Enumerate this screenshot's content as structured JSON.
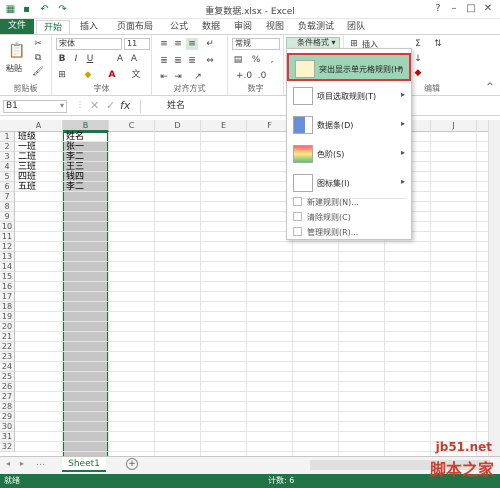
{
  "title": "重复数据.xlsx - Excel",
  "tabs": [
    "文件",
    "开始",
    "插入",
    "页面布局",
    "公式",
    "数据",
    "审阅",
    "视图",
    "负载测试",
    "团队"
  ],
  "ribbon": {
    "paste": "粘贴",
    "font_name": "宋体",
    "font_size": "11",
    "number_format": "常规",
    "cond_format": "条件格式",
    "insert": "插入",
    "groups": [
      "剪贴板",
      "字体",
      "对齐方式",
      "数字",
      "编辑"
    ]
  },
  "formula_bar": {
    "name_box": "B1",
    "content": "姓名"
  },
  "columns": [
    "A",
    "B",
    "C",
    "D",
    "E",
    "F",
    "G",
    "H",
    "I",
    "J"
  ],
  "rows": [
    "1",
    "2",
    "3",
    "4",
    "5",
    "6",
    "7",
    "8",
    "9",
    "10",
    "11",
    "12",
    "13",
    "14",
    "15",
    "16",
    "17",
    "18",
    "19",
    "20",
    "21",
    "22",
    "23",
    "24",
    "25",
    "26",
    "27",
    "28",
    "29",
    "30",
    "31",
    "32"
  ],
  "cells": [
    [
      "班级",
      "姓名"
    ],
    [
      "一班",
      "张一"
    ],
    [
      "二班",
      "李二"
    ],
    [
      "三班",
      "王三"
    ],
    [
      "四班",
      "钱四"
    ],
    [
      "五班",
      "李二"
    ]
  ],
  "menu": {
    "items": [
      {
        "label": "突出显示单元格规则(H)",
        "icon": "highlight-rules-icon"
      },
      {
        "label": "项目选取规则(T)",
        "icon": "top-bottom-rules-icon"
      },
      {
        "label": "数据条(D)",
        "icon": "data-bars-icon"
      },
      {
        "label": "色阶(S)",
        "icon": "color-scales-icon"
      },
      {
        "label": "图标集(I)",
        "icon": "icon-sets-icon"
      }
    ],
    "small": [
      "新建规则(N)...",
      "清除规则(C)",
      "管理规则(R)..."
    ]
  },
  "sheet_tab": "Sheet1",
  "status": {
    "ready": "就绪",
    "count": "计数: 6"
  },
  "watermark": {
    "url": "jb51.net",
    "text": "脚本之家"
  },
  "colors": {
    "accent": "#217346",
    "highlight": "#9fd5b7",
    "border_red": "#d9363e"
  }
}
